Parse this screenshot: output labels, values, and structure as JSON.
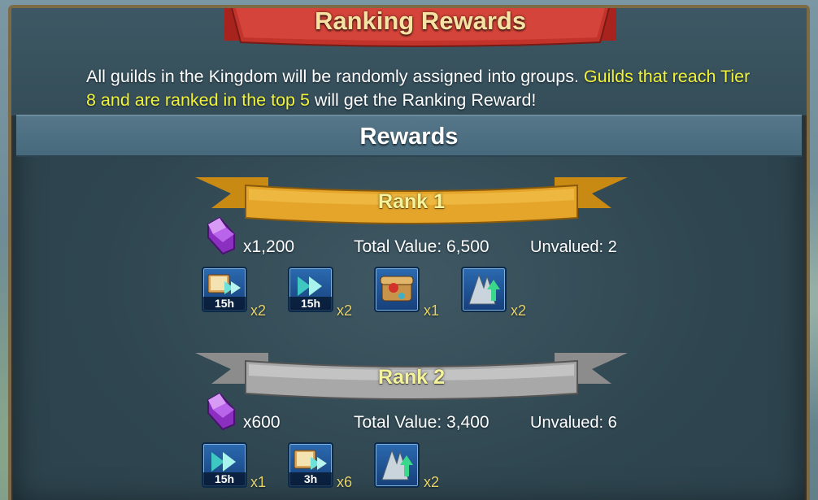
{
  "title": "Ranking Rewards",
  "description": {
    "part1": "All guilds in the Kingdom will be randomly assigned into groups. ",
    "highlight": "Guilds that reach Tier 8 and are ranked in the top 5",
    "part2": " will get the Ranking Reward!"
  },
  "rewards_header": "Rewards",
  "ranks": [
    {
      "label": "Rank 1",
      "gems": "x1,200",
      "total_value": "Total Value: 6,500",
      "unvalued": "Unvalued: 2",
      "items": [
        {
          "icon": "research-speedup-icon",
          "duration": "15h",
          "qty": "x2"
        },
        {
          "icon": "speedup-icon",
          "duration": "15h",
          "qty": "x2"
        },
        {
          "icon": "scroll-chest-icon",
          "duration": "",
          "qty": "x1"
        },
        {
          "icon": "guild-tier-boost-icon",
          "duration": "",
          "qty": "x2"
        }
      ]
    },
    {
      "label": "Rank 2",
      "gems": "x600",
      "total_value": "Total Value: 3,400",
      "unvalued": "Unvalued: 6",
      "items": [
        {
          "icon": "speedup-icon",
          "duration": "15h",
          "qty": "x1"
        },
        {
          "icon": "research-speedup-icon",
          "duration": "3h",
          "qty": "x6"
        },
        {
          "icon": "guild-tier-boost-icon",
          "duration": "",
          "qty": "x2"
        }
      ]
    }
  ]
}
